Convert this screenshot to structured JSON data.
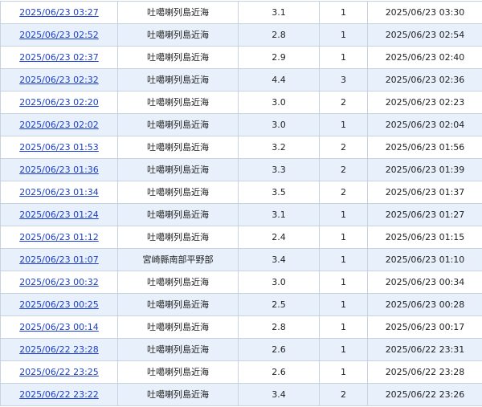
{
  "rows": [
    {
      "time": "2025/06/23 03:27",
      "area": "吐噶喇列島近海",
      "magnitude": "3.1",
      "intensity": "1",
      "announced": "2025/06/23 03:30"
    },
    {
      "time": "2025/06/23 02:52",
      "area": "吐噶喇列島近海",
      "magnitude": "2.8",
      "intensity": "1",
      "announced": "2025/06/23 02:54"
    },
    {
      "time": "2025/06/23 02:37",
      "area": "吐噶喇列島近海",
      "magnitude": "2.9",
      "intensity": "1",
      "announced": "2025/06/23 02:40"
    },
    {
      "time": "2025/06/23 02:32",
      "area": "吐噶喇列島近海",
      "magnitude": "4.4",
      "intensity": "3",
      "announced": "2025/06/23 02:36"
    },
    {
      "time": "2025/06/23 02:20",
      "area": "吐噶喇列島近海",
      "magnitude": "3.0",
      "intensity": "2",
      "announced": "2025/06/23 02:23"
    },
    {
      "time": "2025/06/23 02:02",
      "area": "吐噶喇列島近海",
      "magnitude": "3.0",
      "intensity": "1",
      "announced": "2025/06/23 02:04"
    },
    {
      "time": "2025/06/23 01:53",
      "area": "吐噶喇列島近海",
      "magnitude": "3.2",
      "intensity": "2",
      "announced": "2025/06/23 01:56"
    },
    {
      "time": "2025/06/23 01:36",
      "area": "吐噶喇列島近海",
      "magnitude": "3.3",
      "intensity": "2",
      "announced": "2025/06/23 01:39"
    },
    {
      "time": "2025/06/23 01:34",
      "area": "吐噶喇列島近海",
      "magnitude": "3.5",
      "intensity": "2",
      "announced": "2025/06/23 01:37"
    },
    {
      "time": "2025/06/23 01:24",
      "area": "吐噶喇列島近海",
      "magnitude": "3.1",
      "intensity": "1",
      "announced": "2025/06/23 01:27"
    },
    {
      "time": "2025/06/23 01:12",
      "area": "吐噶喇列島近海",
      "magnitude": "2.4",
      "intensity": "1",
      "announced": "2025/06/23 01:15"
    },
    {
      "time": "2025/06/23 01:07",
      "area": "宮崎縣南部平野部",
      "magnitude": "3.4",
      "intensity": "1",
      "announced": "2025/06/23 01:10"
    },
    {
      "time": "2025/06/23 00:32",
      "area": "吐噶喇列島近海",
      "magnitude": "3.0",
      "intensity": "1",
      "announced": "2025/06/23 00:34"
    },
    {
      "time": "2025/06/23 00:25",
      "area": "吐噶喇列島近海",
      "magnitude": "2.5",
      "intensity": "1",
      "announced": "2025/06/23 00:28"
    },
    {
      "time": "2025/06/23 00:14",
      "area": "吐噶喇列島近海",
      "magnitude": "2.8",
      "intensity": "1",
      "announced": "2025/06/23 00:17"
    },
    {
      "time": "2025/06/22 23:28",
      "area": "吐噶喇列島近海",
      "magnitude": "2.6",
      "intensity": "1",
      "announced": "2025/06/22 23:31"
    },
    {
      "time": "2025/06/22 23:25",
      "area": "吐噶喇列島近海",
      "magnitude": "2.6",
      "intensity": "1",
      "announced": "2025/06/22 23:28"
    },
    {
      "time": "2025/06/22 23:22",
      "area": "吐噶喇列島近海",
      "magnitude": "3.4",
      "intensity": "2",
      "announced": "2025/06/22 23:26"
    }
  ]
}
